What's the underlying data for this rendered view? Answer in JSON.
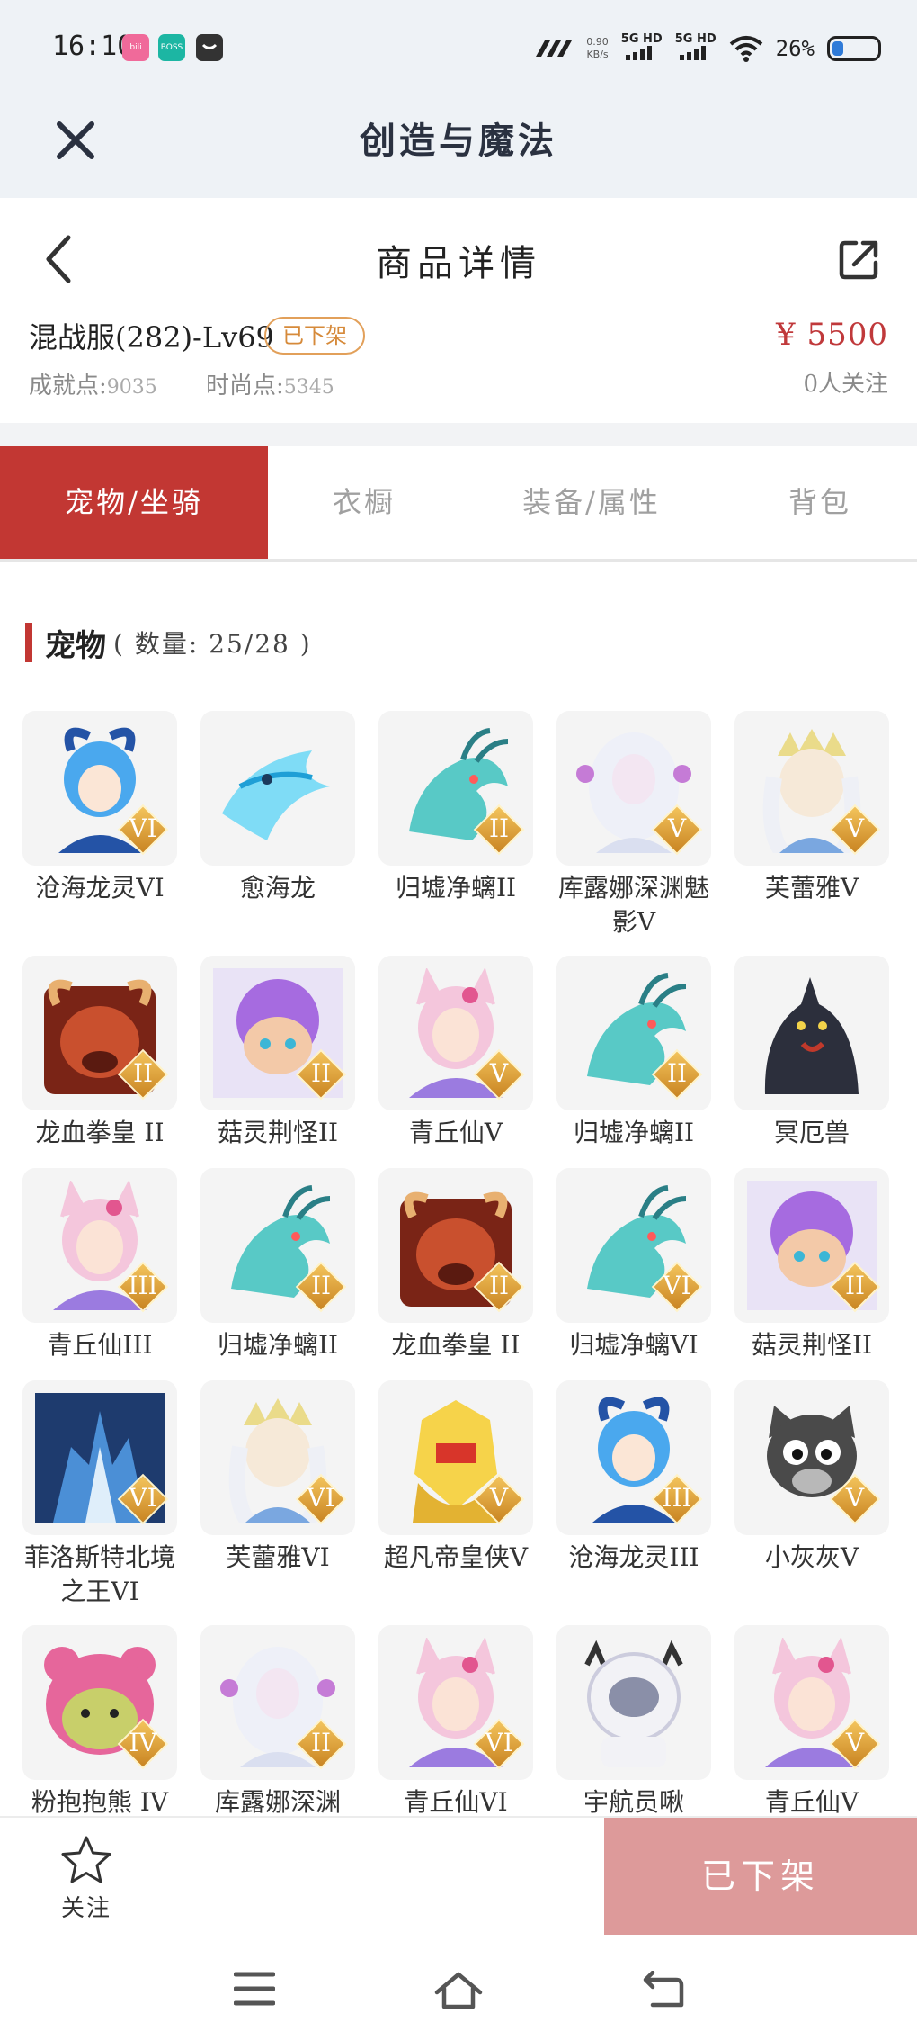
{
  "status_bar": {
    "time": "16:10",
    "apps": [
      {
        "name": "bilibili",
        "color": "#f06a9a"
      },
      {
        "name": "BOSS直聘",
        "color": "#1cb6a3"
      },
      {
        "name": "chat",
        "color": "#333333"
      }
    ],
    "net_speed_value": "0.90",
    "net_speed_unit": "KB/s",
    "signal_1": "5G HD",
    "signal_2": "5G HD",
    "battery": "26%"
  },
  "app_header": {
    "title": "创造与魔法",
    "close_icon": "close-icon"
  },
  "nav": {
    "title": "商品详情",
    "back_icon": "back-arrow-icon",
    "share_icon": "share-icon"
  },
  "product": {
    "name": "混战服(282)-Lv69",
    "status_badge": "已下架",
    "price": "¥ 5500",
    "achievement_label": "成就点:",
    "achievement_value": "9035",
    "fashion_label": "时尚点:",
    "fashion_value": "5345",
    "followers": "0人关注"
  },
  "tabs": [
    {
      "label": "宠物/坐骑",
      "active": true
    },
    {
      "label": "衣橱",
      "active": false
    },
    {
      "label": "装备/属性",
      "active": false
    },
    {
      "label": "背包",
      "active": false
    }
  ],
  "section": {
    "title": "宠物",
    "count": "( 数量: 25/28 )"
  },
  "pets": [
    {
      "name": "沧海龙灵VI",
      "badge": "VI",
      "art": "dragon-boy",
      "c1": "#4aa8ee",
      "c2": "#2453a6"
    },
    {
      "name": "愈海龙",
      "badge": "",
      "art": "sea-dragon",
      "c1": "#7fdcf6",
      "c2": "#1f9fd6"
    },
    {
      "name": "归墟净螭II",
      "badge": "II",
      "art": "teal-dragon",
      "c1": "#58c9c6",
      "c2": "#2a7f86"
    },
    {
      "name": "库露娜深渊魅影V",
      "badge": "V",
      "art": "white-girl",
      "c1": "#eef0f8",
      "c2": "#c57bd6"
    },
    {
      "name": "芙蕾雅V",
      "badge": "V",
      "art": "gold-girl",
      "c1": "#eadb8a",
      "c2": "#7aa7e0"
    },
    {
      "name": "龙血拳皇 II",
      "badge": "II",
      "art": "red-beast",
      "c1": "#c9502e",
      "c2": "#7a2416"
    },
    {
      "name": "菇灵荆怪II",
      "badge": "II",
      "art": "purple-sprite",
      "c1": "#a66be0",
      "c2": "#f3c9a8"
    },
    {
      "name": "青丘仙V",
      "badge": "V",
      "art": "fox-girl",
      "c1": "#f4c6dc",
      "c2": "#9b7be0"
    },
    {
      "name": "归墟净螭II",
      "badge": "II",
      "art": "teal-dragon",
      "c1": "#58c9c6",
      "c2": "#2a7f86"
    },
    {
      "name": "冥厄兽",
      "badge": "",
      "art": "dark-beast",
      "c1": "#2c2f3c",
      "c2": "#c0392b"
    },
    {
      "name": "青丘仙III",
      "badge": "III",
      "art": "fox-girl",
      "c1": "#f4c6dc",
      "c2": "#9b7be0"
    },
    {
      "name": "归墟净螭II",
      "badge": "II",
      "art": "teal-dragon",
      "c1": "#58c9c6",
      "c2": "#2a7f86"
    },
    {
      "name": "龙血拳皇 II",
      "badge": "II",
      "art": "red-beast",
      "c1": "#c9502e",
      "c2": "#7a2416"
    },
    {
      "name": "归墟净螭VI",
      "badge": "VI",
      "art": "teal-dragon",
      "c1": "#58c9c6",
      "c2": "#2a7f86"
    },
    {
      "name": "菇灵荆怪II",
      "badge": "II",
      "art": "purple-sprite",
      "c1": "#a66be0",
      "c2": "#f3c9a8"
    },
    {
      "name": "菲洛斯特北境之王VI",
      "badge": "VI",
      "art": "ice-king",
      "c1": "#4b8fd6",
      "c2": "#dfeefa"
    },
    {
      "name": "芙蕾雅VI",
      "badge": "VI",
      "art": "gold-girl",
      "c1": "#eadb8a",
      "c2": "#7aa7e0"
    },
    {
      "name": "超凡帝皇侠V",
      "badge": "V",
      "art": "gold-armor",
      "c1": "#f6d34a",
      "c2": "#d8352a"
    },
    {
      "name": "沧海龙灵III",
      "badge": "III",
      "art": "dragon-boy",
      "c1": "#4aa8ee",
      "c2": "#2453a6"
    },
    {
      "name": "小灰灰V",
      "badge": "V",
      "art": "grey-wolf",
      "c1": "#4a4a4a",
      "c2": "#b8b8b8"
    },
    {
      "name": "粉抱抱熊 IV",
      "badge": "IV",
      "art": "pink-bear",
      "c1": "#e6669b",
      "c2": "#c8cf6a"
    },
    {
      "name": "库露娜深渊",
      "badge": "II",
      "art": "white-girl",
      "c1": "#eef0f8",
      "c2": "#c57bd6"
    },
    {
      "name": "青丘仙VI",
      "badge": "VI",
      "art": "fox-girl",
      "c1": "#f4c6dc",
      "c2": "#9b7be0"
    },
    {
      "name": "宇航员啾",
      "badge": "",
      "art": "astronaut",
      "c1": "#f2f2f6",
      "c2": "#8a8fa8"
    },
    {
      "name": "青丘仙V",
      "badge": "V",
      "art": "fox-girl",
      "c1": "#f4c6dc",
      "c2": "#9b7be0"
    }
  ],
  "action_bar": {
    "follow_label": "关注",
    "status_button": "已下架"
  },
  "colors": {
    "accent": "#c23733",
    "price": "#c0393b",
    "badge": "#d68a3a",
    "delisted": "#dd9a9a"
  }
}
